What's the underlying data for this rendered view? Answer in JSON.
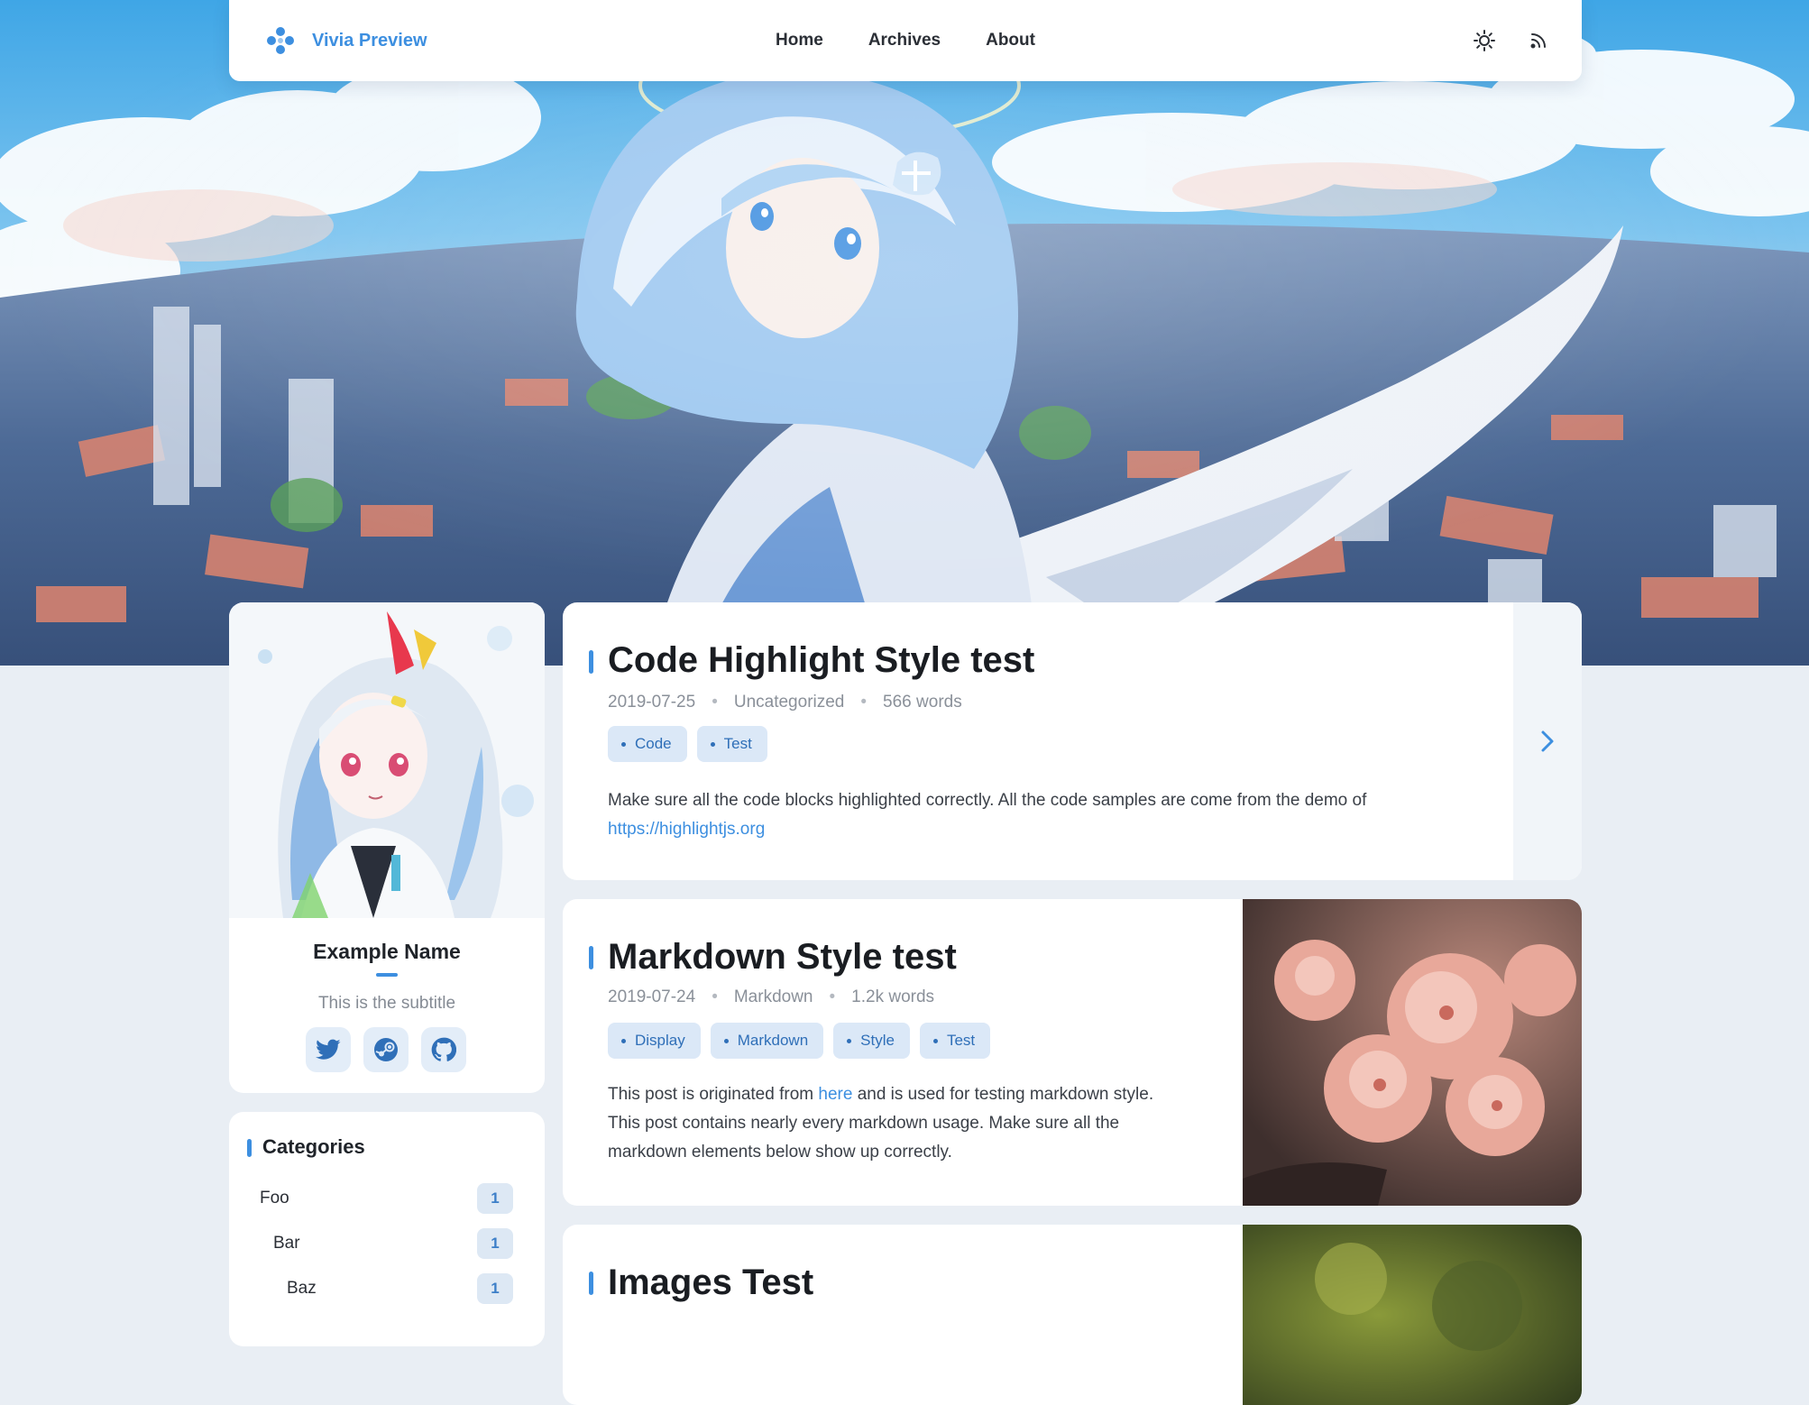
{
  "navbar": {
    "brand": "Vivia Preview",
    "links": [
      "Home",
      "Archives",
      "About"
    ],
    "icons": [
      "theme-toggle-sun-icon",
      "rss-icon"
    ]
  },
  "profile": {
    "name": "Example Name",
    "subtitle": "This is the subtitle",
    "socials": [
      "twitter-icon",
      "steam-icon",
      "github-icon"
    ]
  },
  "categories": {
    "title": "Categories",
    "items": [
      {
        "label": "Foo",
        "count": "1",
        "level": 0
      },
      {
        "label": "Bar",
        "count": "1",
        "level": 1
      },
      {
        "label": "Baz",
        "count": "1",
        "level": 2
      }
    ]
  },
  "posts": [
    {
      "title": "Code Highlight Style test",
      "date": "2019-07-25",
      "category": "Uncategorized",
      "words": "566 words",
      "tags": [
        "Code",
        "Test"
      ],
      "excerpt_text": "Make sure all the code blocks highlighted correctly. All the code samples are come from the demo of",
      "excerpt_link": "https://highlightjs.org"
    },
    {
      "title": "Markdown Style test",
      "date": "2019-07-24",
      "category": "Markdown",
      "words": "1.2k words",
      "tags": [
        "Display",
        "Markdown",
        "Style",
        "Test"
      ],
      "excerpt_before": "This post is originated from",
      "excerpt_link": "here",
      "excerpt_after": "and is used for testing markdown style.",
      "excerpt_line2": "This post contains nearly every markdown usage. Make sure all the",
      "excerpt_line3": "markdown elements below show up correctly."
    },
    {
      "title": "Images Test"
    }
  ],
  "colors": {
    "accent": "#3d8fe0",
    "page_bg": "#e9eef4",
    "tag_bg": "#dbe8f7"
  }
}
